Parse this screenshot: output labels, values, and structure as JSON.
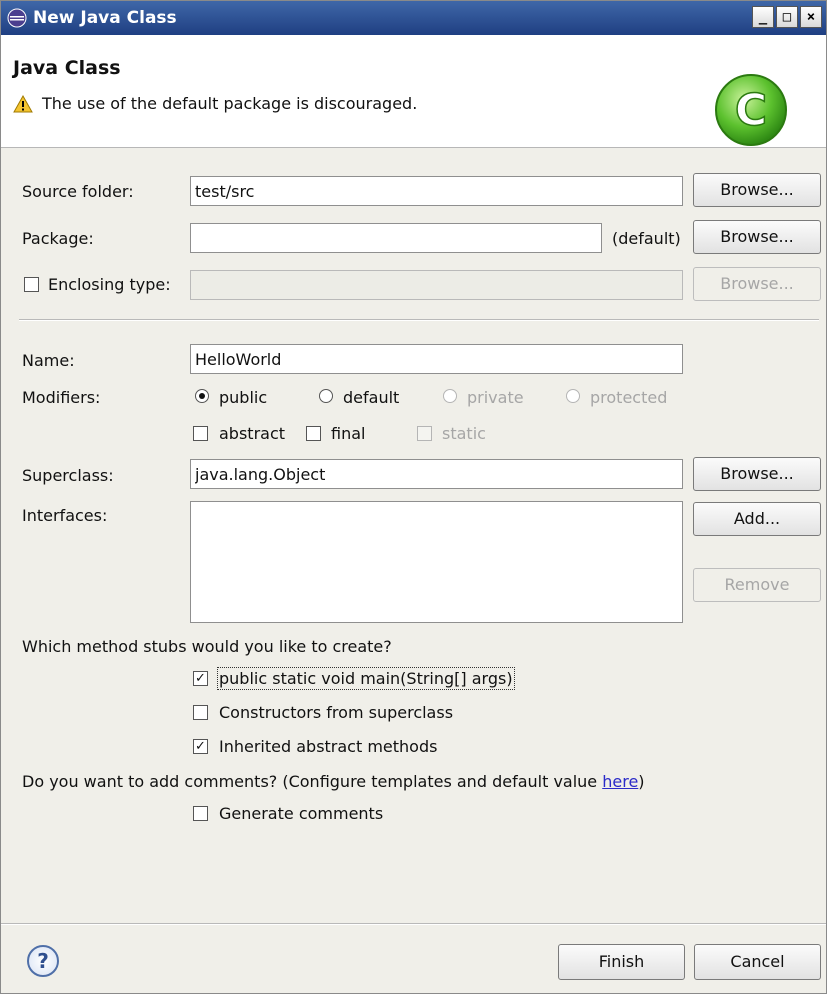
{
  "window": {
    "title": "New Java Class",
    "controls": {
      "minimize": "_",
      "maximize": "□",
      "close": "×"
    }
  },
  "header": {
    "title": "Java Class",
    "warning": "The use of the default package is discouraged.",
    "warning_icon": "warning-triangle-icon",
    "logo_icon": "java-class-logo-icon",
    "logo_letter": "C"
  },
  "source_folder": {
    "label": "Source folder:",
    "value": "test/src",
    "browse": "Browse..."
  },
  "package": {
    "label": "Package:",
    "value": "",
    "suffix": "(default)",
    "browse": "Browse..."
  },
  "enclosing": {
    "label": "Enclosing type:",
    "checked": false,
    "value": "",
    "browse": "Browse..."
  },
  "name": {
    "label": "Name:",
    "value": "HelloWorld"
  },
  "modifiers": {
    "label": "Modifiers:",
    "radios": [
      {
        "label": "public",
        "checked": true,
        "enabled": true
      },
      {
        "label": "default",
        "checked": false,
        "enabled": true
      },
      {
        "label": "private",
        "checked": false,
        "enabled": false
      },
      {
        "label": "protected",
        "checked": false,
        "enabled": false
      }
    ],
    "checks": [
      {
        "label": "abstract",
        "checked": false,
        "enabled": true
      },
      {
        "label": "final",
        "checked": false,
        "enabled": true
      },
      {
        "label": "static",
        "checked": false,
        "enabled": false
      }
    ]
  },
  "superclass": {
    "label": "Superclass:",
    "value": "java.lang.Object",
    "browse": "Browse..."
  },
  "interfaces": {
    "label": "Interfaces:",
    "add": "Add...",
    "remove": "Remove"
  },
  "stubs": {
    "question": "Which method stubs would you like to create?",
    "options": [
      {
        "label": "public static void main(String[] args)",
        "checked": true
      },
      {
        "label": "Constructors from superclass",
        "checked": false
      },
      {
        "label": "Inherited abstract methods",
        "checked": true
      }
    ]
  },
  "comments": {
    "question_prefix": "Do you want to add comments? (Configure templates and default value ",
    "link": "here",
    "question_suffix": ")",
    "option": {
      "label": "Generate comments",
      "checked": false
    }
  },
  "footer": {
    "help": "?",
    "finish": "Finish",
    "cancel": "Cancel"
  }
}
